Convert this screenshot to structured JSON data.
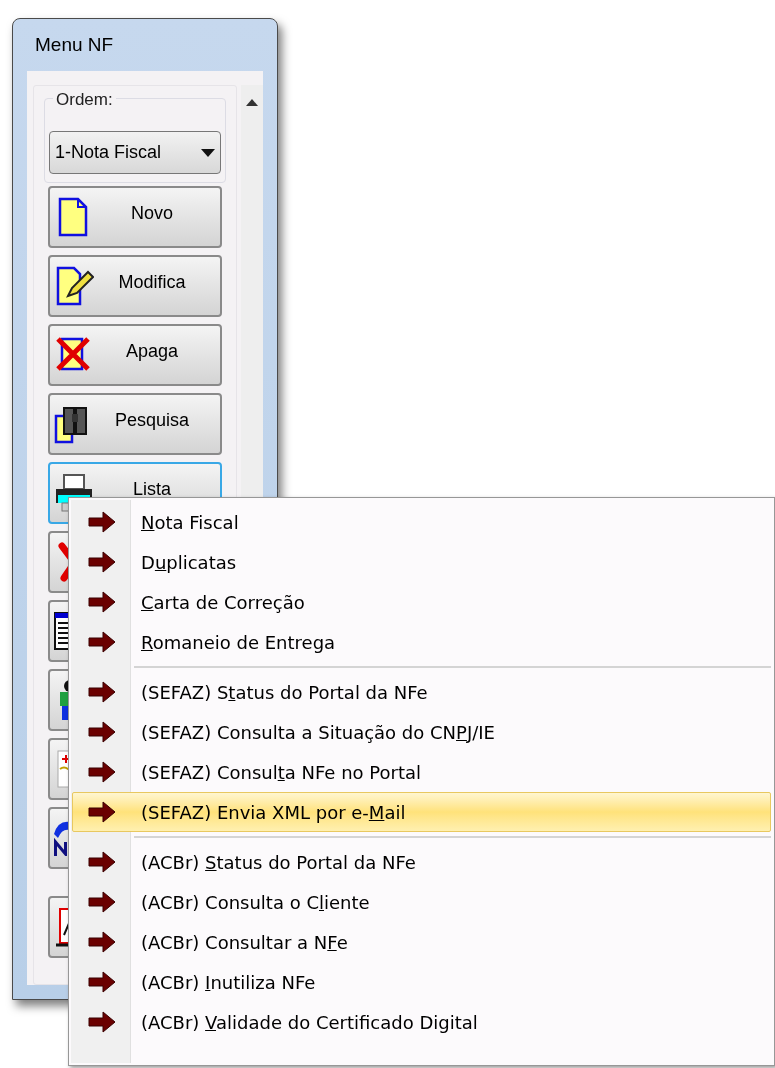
{
  "window": {
    "title": "Menu NF"
  },
  "order_group": {
    "label": "Ordem:",
    "combo": {
      "value": "1-Nota Fiscal"
    }
  },
  "buttons": [
    {
      "label": "Novo",
      "focused": false
    },
    {
      "label": "Modifica",
      "focused": false
    },
    {
      "label": "Apaga",
      "focused": false
    },
    {
      "label": "Pesquisa",
      "focused": false
    },
    {
      "label": "Lista",
      "focused": true
    },
    {
      "focused": false
    },
    {
      "focused": false
    },
    {
      "focused": false
    },
    {
      "focused": false
    },
    {
      "focused": false
    },
    {
      "focused": false
    }
  ],
  "context_menu": {
    "items": [
      {
        "kind": "item",
        "accel": "N",
        "after": "ota Fiscal",
        "selected": false
      },
      {
        "kind": "item",
        "before": "D",
        "accel": "u",
        "after": "plicatas",
        "selected": false
      },
      {
        "kind": "item",
        "accel": "C",
        "after": "arta de Correção",
        "selected": false
      },
      {
        "kind": "item",
        "accel": "R",
        "after": "omaneio de Entrega",
        "selected": false
      },
      {
        "kind": "separator"
      },
      {
        "kind": "item",
        "before": "(SEFAZ) S",
        "accel": "t",
        "after": "atus do Portal da NFe",
        "selected": false
      },
      {
        "kind": "item",
        "before": "(SEFAZ) Consulta a Situação do CN",
        "accel": "P",
        "after": "J/IE",
        "selected": false
      },
      {
        "kind": "item",
        "before": "(SEFAZ) Consul",
        "accel": "t",
        "after": "a NFe no Portal",
        "selected": false
      },
      {
        "kind": "item",
        "before": "(SEFAZ) Envia XML por e-",
        "accel": "M",
        "after": "ail",
        "selected": true
      },
      {
        "kind": "separator"
      },
      {
        "kind": "item",
        "before": "(ACBr) ",
        "accel": "S",
        "after": "tatus do Portal da NFe",
        "selected": false
      },
      {
        "kind": "item",
        "before": "(ACBr) Consulta o C",
        "accel": "l",
        "after": "iente",
        "selected": false
      },
      {
        "kind": "item",
        "before": "(ACBr) Consultar a N",
        "accel": "F",
        "after": "e",
        "selected": false
      },
      {
        "kind": "item",
        "before": "(ACBr) ",
        "accel": "I",
        "after": "nutiliza NFe",
        "selected": false
      },
      {
        "kind": "item",
        "before": "(ACBr) ",
        "accel": "V",
        "after": "alidade do Certificado Digital",
        "selected": false
      }
    ]
  }
}
